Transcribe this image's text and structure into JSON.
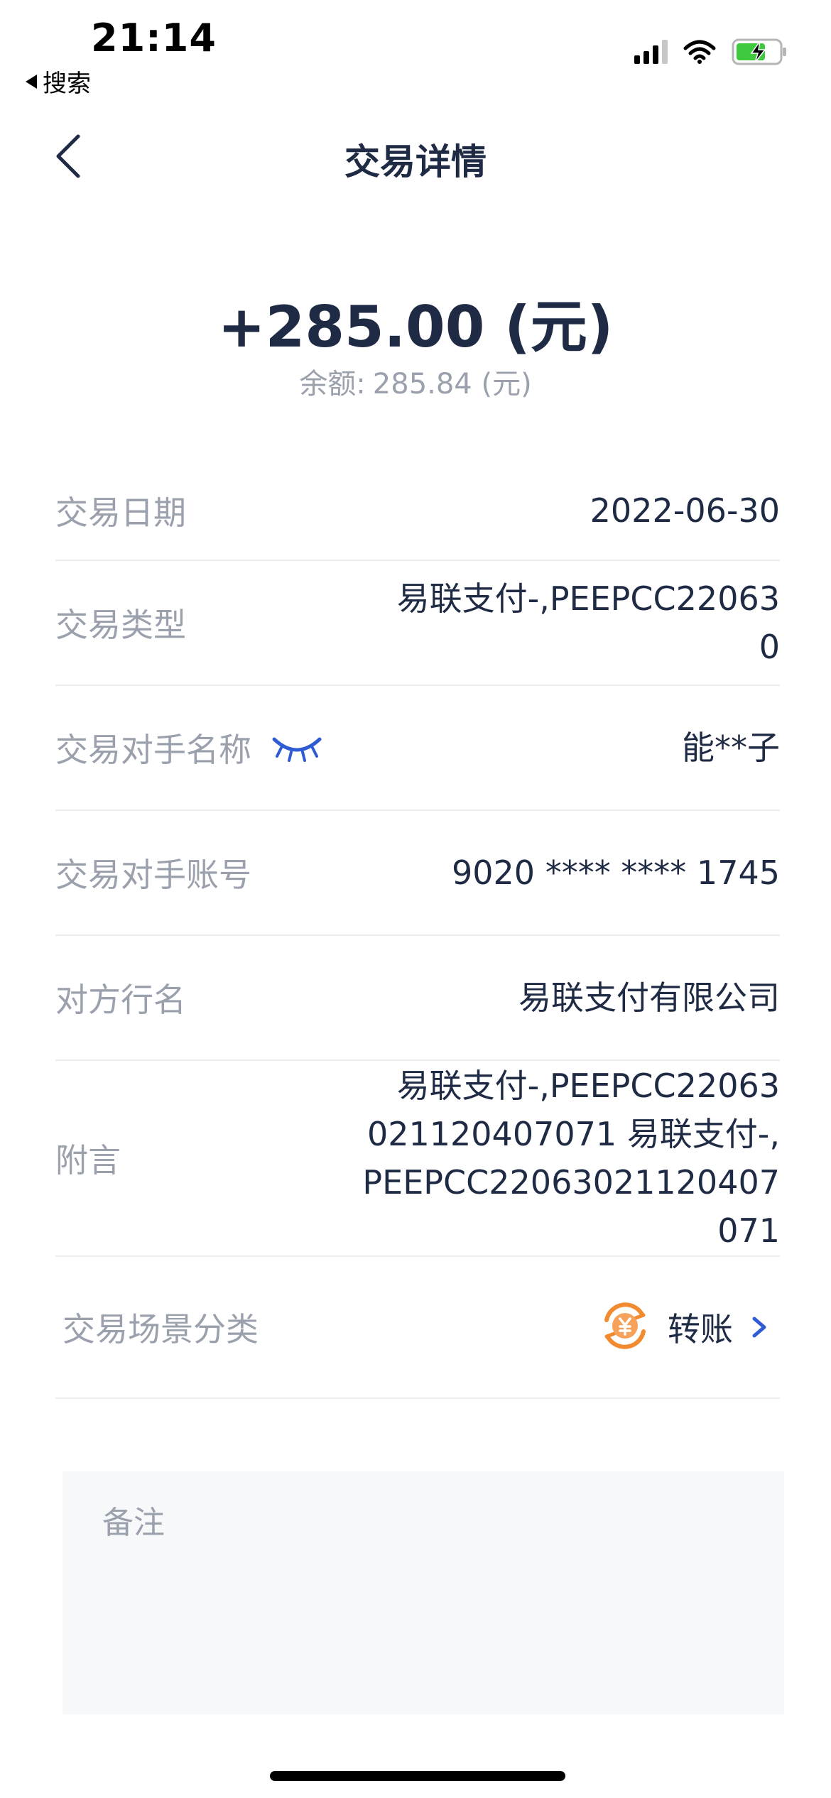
{
  "status_bar": {
    "time": "21:14",
    "back_app": "搜索",
    "icons": [
      "signal-icon",
      "wifi-icon",
      "battery-charging-icon"
    ]
  },
  "nav": {
    "title": "交易详情",
    "back_icon": "chevron-left-icon"
  },
  "summary": {
    "amount": "+285.00 (元)",
    "balance_label": "余额:",
    "balance_value": "285.84 (元)"
  },
  "details": {
    "date": {
      "label": "交易日期",
      "value": "2022-06-30"
    },
    "type": {
      "label": "交易类型",
      "value_line1": "易联支付-,PEEPCC22063",
      "value_line2": "0"
    },
    "counterparty_name": {
      "label": "交易对手名称",
      "value": "能**子",
      "icon": "eye-closed-icon"
    },
    "counterparty_account": {
      "label": "交易对手账号",
      "value": "9020 **** **** 1745"
    },
    "bank_name": {
      "label": "对方行名",
      "value": "易联支付有限公司"
    },
    "postscript": {
      "label": "附言",
      "value_line1": "易联支付-,PEEPCC22063",
      "value_line2": "021120407071 易联支付-,",
      "value_line3": "PEEPCC22063021120407",
      "value_line4": "071"
    },
    "scene": {
      "label": "交易场景分类",
      "value": "转账",
      "icon": "transfer-yuan-icon"
    }
  },
  "remark": {
    "label": "备注"
  },
  "colors": {
    "text_primary": "#1f2a44",
    "text_secondary": "#9aa0ac",
    "accent_blue": "#2f5bd3",
    "accent_orange": "#f28a30",
    "divider": "#e9ebef",
    "battery_green": "#3ec93e"
  }
}
